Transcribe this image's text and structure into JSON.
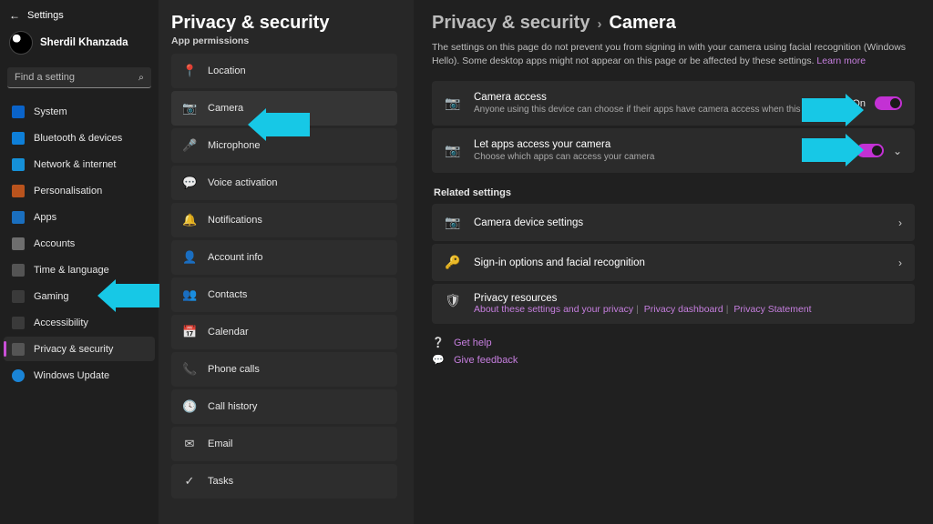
{
  "window": {
    "app_title": "Settings"
  },
  "user": {
    "name": "Sherdil Khanzada"
  },
  "search": {
    "placeholder": "Find a setting"
  },
  "nav": {
    "items": [
      {
        "label": "System",
        "icon": "desktop"
      },
      {
        "label": "Bluetooth & devices",
        "icon": "bluetooth"
      },
      {
        "label": "Network & internet",
        "icon": "wifi"
      },
      {
        "label": "Personalisation",
        "icon": "brush"
      },
      {
        "label": "Apps",
        "icon": "apps"
      },
      {
        "label": "Accounts",
        "icon": "person"
      },
      {
        "label": "Time & language",
        "icon": "clock"
      },
      {
        "label": "Gaming",
        "icon": "game"
      },
      {
        "label": "Accessibility",
        "icon": "accessibility"
      },
      {
        "label": "Privacy & security",
        "icon": "shield",
        "active": true
      },
      {
        "label": "Windows Update",
        "icon": "update"
      }
    ]
  },
  "mid": {
    "title": "Privacy & security",
    "subtitle": "App permissions",
    "items": [
      {
        "label": "Location",
        "icon": "📍"
      },
      {
        "label": "Camera",
        "icon": "📷",
        "selected": true
      },
      {
        "label": "Microphone",
        "icon": "🎤"
      },
      {
        "label": "Voice activation",
        "icon": "💬"
      },
      {
        "label": "Notifications",
        "icon": "🔔"
      },
      {
        "label": "Account info",
        "icon": "👤"
      },
      {
        "label": "Contacts",
        "icon": "👥"
      },
      {
        "label": "Calendar",
        "icon": "📅"
      },
      {
        "label": "Phone calls",
        "icon": "📞"
      },
      {
        "label": "Call history",
        "icon": "🕓"
      },
      {
        "label": "Email",
        "icon": "✉"
      },
      {
        "label": "Tasks",
        "icon": "✓"
      }
    ]
  },
  "detail": {
    "breadcrumb_parent": "Privacy & security",
    "breadcrumb_sep": "›",
    "breadcrumb_current": "Camera",
    "description": "The settings on this page do not prevent you from signing in with your camera using facial recognition (Windows Hello). Some desktop apps might not appear on this page or be affected by these settings.",
    "learn_more": "Learn more",
    "toggles": [
      {
        "title": "Camera access",
        "sub": "Anyone using this device can choose if their apps have camera access when this is on",
        "state": "On"
      },
      {
        "title": "Let apps access your camera",
        "sub": "Choose which apps can access your camera",
        "state": "On",
        "expandable": true
      }
    ],
    "related_label": "Related settings",
    "related": [
      {
        "title": "Camera device settings",
        "icon": "📷"
      },
      {
        "title": "Sign-in options and facial recognition",
        "icon": "🔑"
      }
    ],
    "resources": {
      "title": "Privacy resources",
      "links": [
        "About these settings and your privacy",
        "Privacy dashboard",
        "Privacy Statement"
      ]
    },
    "footer": {
      "help": "Get help",
      "feedback": "Give feedback"
    }
  }
}
